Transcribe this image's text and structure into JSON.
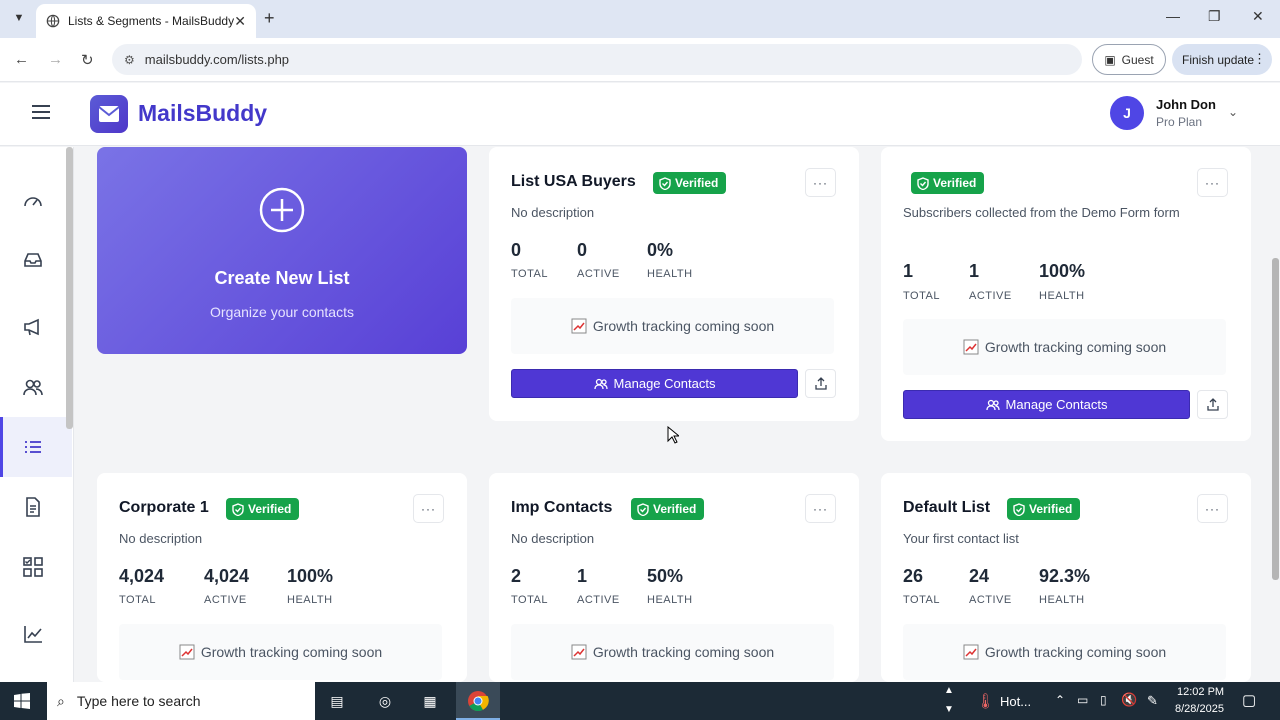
{
  "browser": {
    "tab_title": "Lists & Segments - MailsBuddy",
    "url": "mailsbuddy.com/lists.php",
    "guest_label": "Guest",
    "update_label": "Finish update"
  },
  "app": {
    "brand": "MailsBuddy",
    "user_initial": "J",
    "user_name": "John Don",
    "user_plan": "Pro Plan"
  },
  "create_card": {
    "title": "Create New List",
    "subtitle": "Organize your contacts"
  },
  "labels": {
    "total": "TOTAL",
    "active": "ACTIVE",
    "health": "HEALTH",
    "verified": "Verified",
    "growth": "Growth tracking coming soon",
    "manage": "Manage Contacts"
  },
  "lists": [
    {
      "name": "List USA Buyers",
      "description": "No description",
      "total": "0",
      "active": "0",
      "health": "0%"
    },
    {
      "name": "",
      "description": "Subscribers collected from the Demo Form form",
      "total": "1",
      "active": "1",
      "health": "100%"
    },
    {
      "name": "Corporate 1",
      "description": "No description",
      "total": "4,024",
      "active": "4,024",
      "health": "100%"
    },
    {
      "name": "Imp Contacts",
      "description": "No description",
      "total": "2",
      "active": "1",
      "health": "50%"
    },
    {
      "name": "Default List",
      "description": "Your first contact list",
      "total": "26",
      "active": "24",
      "health": "92.3%"
    }
  ],
  "sidebar_icons": [
    "dashboard-icon",
    "inbox-icon",
    "megaphone-icon",
    "users-icon",
    "list-icon",
    "document-icon",
    "grid-check-icon",
    "chart-icon"
  ],
  "taskbar": {
    "search_placeholder": "Type here to search",
    "weather": "Hot...",
    "time": "12:02 PM",
    "date": "8/28/2025"
  },
  "colors": {
    "accent": "#4f37d4",
    "verified": "#16a34a",
    "brand": "#4338ca"
  }
}
